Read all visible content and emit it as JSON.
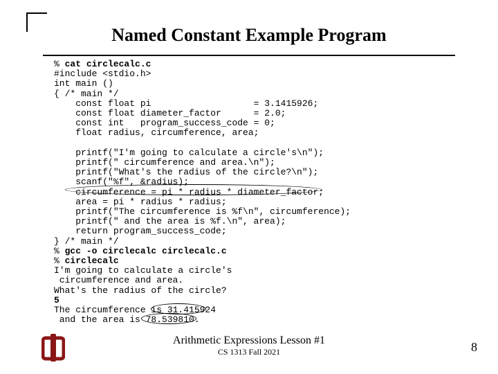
{
  "title": "Named Constant Example Program",
  "code": {
    "l1a": "% ",
    "l1b": "cat circlecalc.c",
    "l2": "#include <stdio.h>",
    "l3": "int main ()",
    "l4": "{ /* main */",
    "l5": "    const float pi                   = 3.1415926;",
    "l6": "    const float diameter_factor      = 2.0;",
    "l7": "    const int   program_success_code = 0;",
    "l8": "    float radius, circumference, area;",
    "blank1": " ",
    "l9": "    printf(\"I'm going to calculate a circle's\\n\");",
    "l10": "    printf(\" circumference and area.\\n\");",
    "l11": "    printf(\"What's the radius of the circle?\\n\");",
    "l12": "    scanf(\"%f\", &radius);",
    "l13": "    circumference = pi * radius * diameter_factor;",
    "l14": "    area = pi * radius * radius;",
    "l15": "    printf(\"The circumference is %f\\n\", circumference);",
    "l16": "    printf(\" and the area is %f.\\n\", area);",
    "l17": "    return program_success_code;",
    "l18": "} /* main */",
    "l19a": "% ",
    "l19b": "gcc -o circlecalc circlecalc.c",
    "l20a": "% ",
    "l20b": "circlecalc",
    "l21": "I'm going to calculate a circle's",
    "l22": " circumference and area.",
    "l23": "What's the radius of the circle?",
    "l24": "5",
    "l25": "The circumference is 31.415924",
    "l26": " and the area is 78.539810."
  },
  "footer": {
    "line1": "Arithmetic Expressions Lesson #1",
    "line2": "CS 1313 Fall 2021"
  },
  "page": "8",
  "logo_color": "#8a1717"
}
